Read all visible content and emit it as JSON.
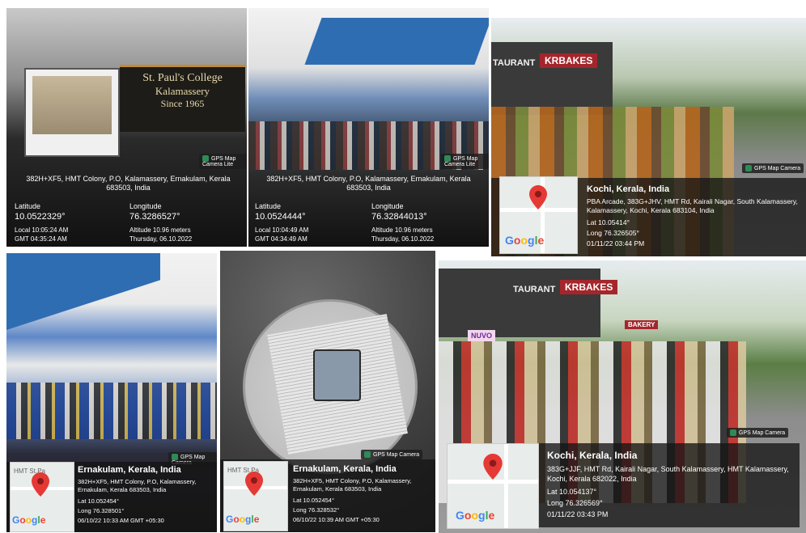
{
  "panels": [
    {
      "id": "p1",
      "banner": [
        "St. Paul's College",
        "Kalamassery",
        "Since 1965"
      ],
      "badge": "GPS Map Camera Lite",
      "address": "382H+XF5, HMT Colony, P.O, Kalamassery, Ernakulam, Kerala 683503, India",
      "lat_label": "Latitude",
      "lat": "10.0522329°",
      "lon_label": "Longitude",
      "lon": "76.3286527°",
      "local": "Local 10:05:24 AM",
      "gmt": "GMT 04:35:24 AM",
      "altitude": "Altitude 10.96 meters",
      "date": "Thursday, 06.10.2022"
    },
    {
      "id": "p2",
      "badge": "GPS Map Camera Lite",
      "address": "382H+XF5, HMT Colony, P.O, Kalamassery, Ernakulam, Kerala 683503, India",
      "lat_label": "Latitude",
      "lat": "10.0524444°",
      "lon_label": "Longitude",
      "lon": "76.32844013°",
      "local": "Local 10:04:49 AM",
      "gmt": "GMT 04:34:49 AM",
      "altitude": "Altitude 10.96 meters",
      "date": "Thursday, 06.10.2022"
    },
    {
      "id": "p3",
      "signs": [
        "TAURANT",
        "KRBAKES"
      ],
      "badge": "GPS Map Camera",
      "title": "Kochi, Kerala, India",
      "address": "PBA Arcade, 383G+JHV, HMT Rd, Kairali Nagar, South Kalamassery, Kalamassery, Kochi, Kerala 683104, India",
      "lat": "Lat 10.05414°",
      "lon": "Long 76.326505°",
      "datetime": "01/11/22 03:44 PM",
      "google": "Google"
    },
    {
      "id": "p4",
      "badge": "GPS Map Camera",
      "title": "Ernakulam, Kerala, India",
      "address": "382H+XF5, HMT Colony, P.O, Kalamassery, Ernakulam, Kerala 683503, India",
      "lat": "Lat 10.052454°",
      "lon": "Long 76.328501°",
      "datetime": "06/10/22 10:33 AM GMT +05:30",
      "map_text": "HMT St.Pa",
      "google": "Google"
    },
    {
      "id": "p5",
      "badge": "GPS Map Camera",
      "title": "Ernakulam, Kerala, India",
      "address": "382H+XF5, HMT Colony, P.O, Kalamassery, Ernakulam, Kerala 683503, India",
      "lat": "Lat 10.052454°",
      "lon": "Long 76.328532°",
      "datetime": "06/10/22 10:39 AM GMT +05:30",
      "map_text": "HMT St.Pa",
      "google": "Google"
    },
    {
      "id": "p6",
      "signs": [
        "TAURANT",
        "KRBAKES",
        "NUVO",
        "BAKERY"
      ],
      "badge": "GPS Map Camera",
      "title": "Kochi, Kerala, India",
      "address": "383G+JJF, HMT Rd, Kairali Nagar, South Kalamassery, HMT Kalamassery, Kochi, Kerala 682022, India",
      "lat": "Lat 10.054137°",
      "lon": "Long 76.326569°",
      "datetime": "01/11/22 03:43 PM",
      "google": "Google"
    }
  ],
  "colors": {
    "stamp_bg": "#1e1e1e",
    "pin": "#e53935",
    "wall_blue": "#2f6db3"
  }
}
